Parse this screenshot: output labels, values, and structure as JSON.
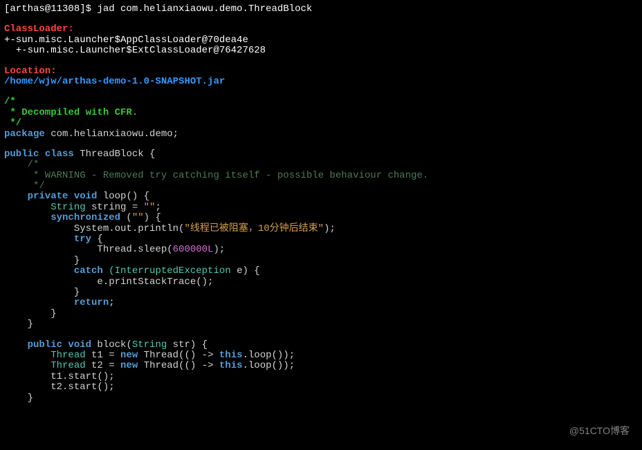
{
  "prompt": "[arthas@11308]$ ",
  "command": "jad com.helianxiaowu.demo.ThreadBlock",
  "classloader_header": "ClassLoader:",
  "classloader_line1": "+-sun.misc.Launcher$AppClassLoader@70dea4e",
  "classloader_line2": "  +-sun.misc.Launcher$ExtClassLoader@76427628",
  "location_header": "Location:",
  "location_path": "/home/wjw/arthas-demo-1.0-SNAPSHOT.jar",
  "comment1_1": "/*",
  "comment1_2": " * Decompiled with CFR.",
  "comment1_3": " */",
  "package_kw": "package",
  "package_name": " com.helianxiaowu.demo;",
  "public_kw": "public",
  "class_kw": " class",
  "class_name": " ThreadBlock {",
  "comment2_1": "    /*",
  "comment2_2": "     * WARNING - Removed try catching itself - possible behaviour change.",
  "comment2_3": "     */",
  "private_kw": "    private",
  "void_kw": " void",
  "method_loop": " loop() {",
  "string_type": "        String",
  "string_var": " string = ",
  "empty_str": "\"\"",
  "semicolon": ";",
  "sync_kw": "        synchronized",
  "sync_arg": " (",
  "sync_str": "\"\"",
  "sync_close": ") {",
  "println_pre": "            System.out.println(",
  "println_str": "\"线程已被阻塞，10分钟后结束\"",
  "println_post": ");",
  "try_kw": "            try",
  "try_brace": " {",
  "sleep_pre": "                Thread.sleep(",
  "sleep_val": "600000L",
  "sleep_post": ");",
  "close1": "            }",
  "catch_kw": "            catch",
  "catch_type": " (InterruptedException",
  "catch_var": " e) {",
  "catch_body": "                e.printStackTrace();",
  "close2": "            }",
  "return_kw": "            return",
  "return_semi": ";",
  "close3": "        }",
  "close4": "    }",
  "public2": "    public",
  "void2": " void",
  "block_method": " block(",
  "block_arg_type": "String",
  "block_arg_name": " str) {",
  "thread_type": "        Thread",
  "t1_var": " t1 = ",
  "new_kw": "new",
  "thread_ctor1": " Thread(() -> ",
  "this_kw": "this",
  "loop_call": ".loop());",
  "t2_var": " t2 = ",
  "t1_start": "        t1.start();",
  "t2_start": "        t2.start();",
  "close5": "    }",
  "watermark": "@51CTO博客"
}
